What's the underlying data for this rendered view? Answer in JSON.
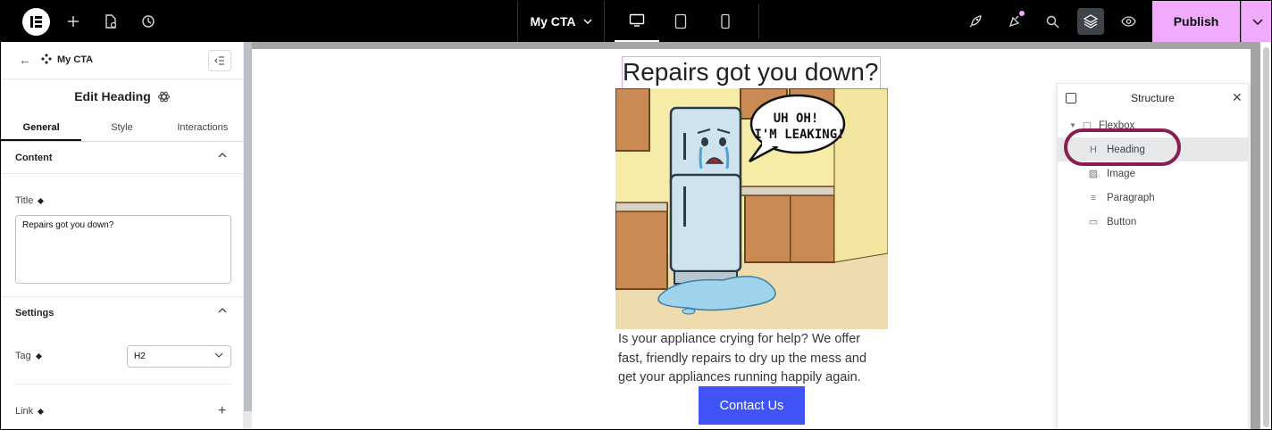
{
  "topbar": {
    "logo_icon": "elementor-logo-icon",
    "add_icon": "plus-icon",
    "pages_icon": "page-settings-icon",
    "history_icon": "history-icon",
    "document_title": "My CTA",
    "devices": [
      "desktop",
      "tablet",
      "mobile"
    ],
    "right_icons": [
      "rocket-icon",
      "notifications-icon",
      "search-icon",
      "layers-icon",
      "preview-eye-icon"
    ],
    "publish_label": "Publish",
    "accent": "#f0abfc"
  },
  "panel": {
    "breadcrumb": "My CTA",
    "edit_title": "Edit Heading",
    "tabs": [
      "General",
      "Style",
      "Interactions"
    ],
    "content_section": "Content",
    "title_label": "Title",
    "title_value": "Repairs got you down?",
    "settings_section": "Settings",
    "tag_label": "Tag",
    "tag_value": "H2",
    "link_label": "Link"
  },
  "canvas": {
    "heading": "Repairs got you down?",
    "image_alt": "Cartoon refrigerator crying and leaking water",
    "bubble_line1": "UH OH!",
    "bubble_line2": "I'M LEAKING!",
    "paragraph": "Is your appliance crying for help? We offer fast, friendly repairs to dry up the mess and get your appliances running happily again.",
    "button": "Contact Us",
    "button_color": "#4054f5"
  },
  "structure": {
    "title": "Structure",
    "items": [
      "Flexbox",
      "Heading",
      "Image",
      "Paragraph",
      "Button"
    ],
    "selected": "Heading"
  }
}
